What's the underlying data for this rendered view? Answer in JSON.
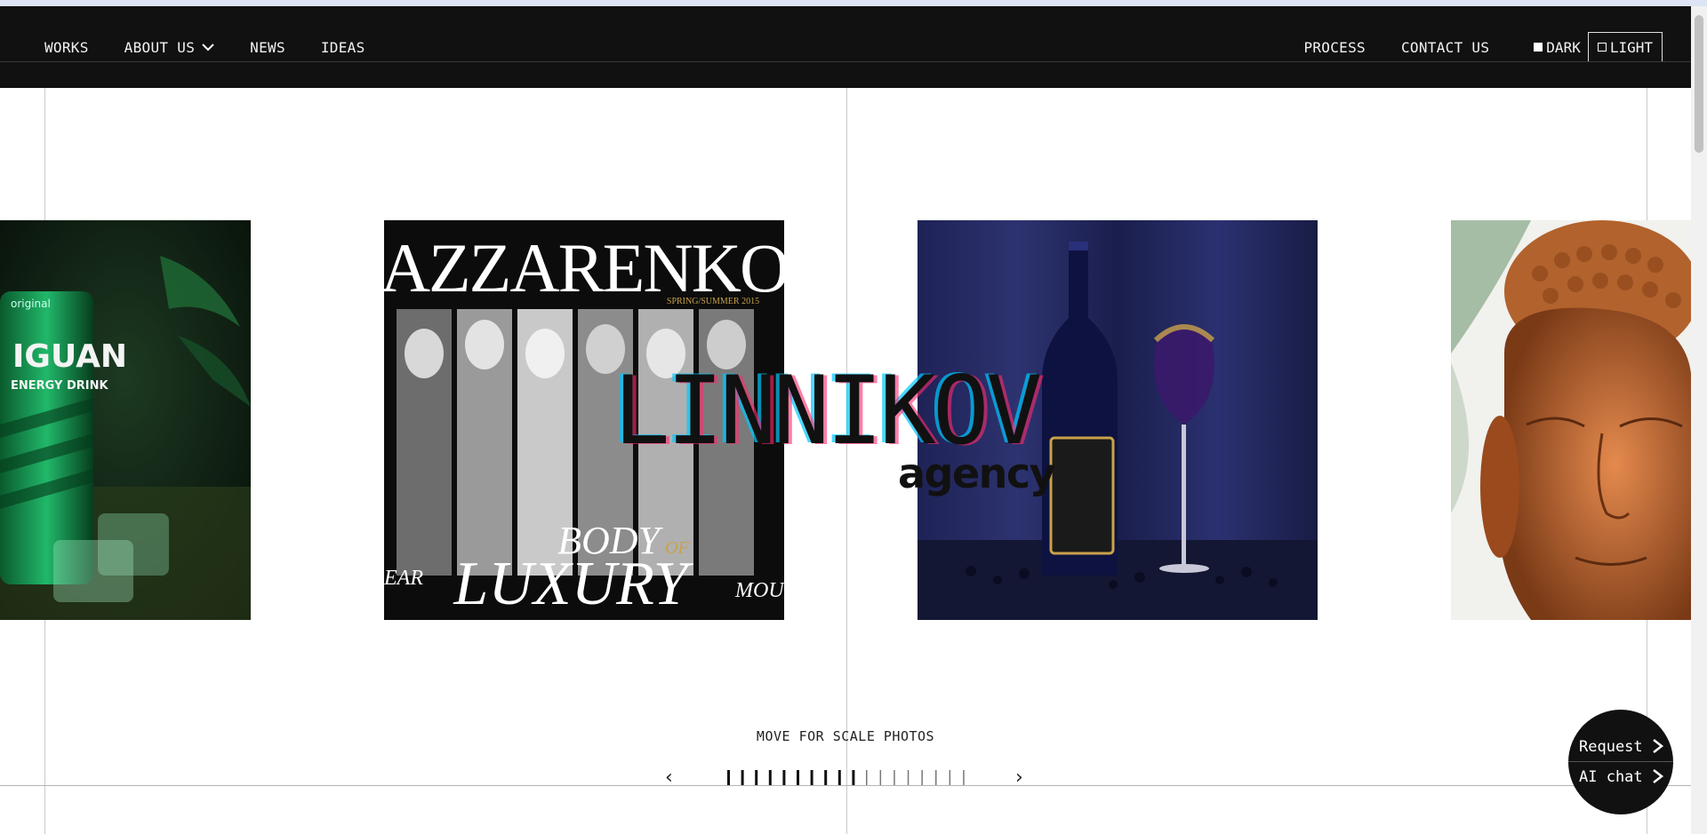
{
  "nav": {
    "left": [
      {
        "label": "WORKS"
      },
      {
        "label": "ABOUT US"
      },
      {
        "label": "NEWS"
      },
      {
        "label": "IDEAS"
      }
    ],
    "right": [
      {
        "label": "PROCESS"
      },
      {
        "label": "CONTACT US"
      }
    ],
    "theme": {
      "dark": "DARK",
      "light": "LIGHT"
    }
  },
  "carousel": {
    "slides": [
      {
        "name": "energy-drink",
        "text_top": "original",
        "text_brand": "IGUAN",
        "text_sub": "ENERGY DRINK"
      },
      {
        "name": "azzarenko-magazine",
        "title": "AZZARENKO",
        "season": "SPRING/SUMMER 2015",
        "headline_small": "BODY",
        "headline_of": "OF",
        "headline_big": "LUXURY",
        "left_fragment": "EAR",
        "right_fragment": "MOU"
      },
      {
        "name": "wine-bottle"
      },
      {
        "name": "buddha-head"
      }
    ]
  },
  "logo": {
    "main": "LINNIKOV",
    "sub": "agency"
  },
  "hint": "MOVE FOR SCALE PHOTOS",
  "pager": {
    "prev": "‹",
    "next": "›",
    "total_ticks": 18,
    "active_ticks": 10
  },
  "cta": {
    "request": "Request",
    "chat": "AI chat"
  }
}
